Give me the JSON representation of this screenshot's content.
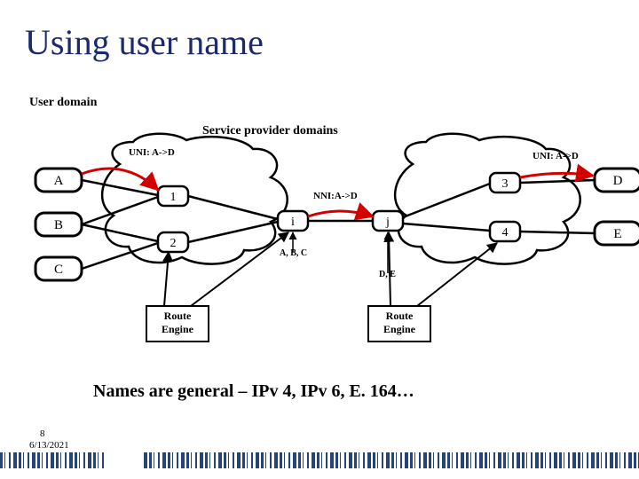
{
  "title": "Using user name",
  "labels": {
    "user_domain": "User domain",
    "service_domains": "Service provider domains",
    "uni_left": "UNI: A->D",
    "uni_right": "UNI: A->D",
    "nni": "NNI:A->D",
    "abc": "A, B, C",
    "de": "D, E",
    "route_engine": "Route\nEngine"
  },
  "nodes": {
    "A": "A",
    "B": "B",
    "C": "C",
    "D": "D",
    "E": "E",
    "n1": "1",
    "n2": "2",
    "n3": "3",
    "n4": "4",
    "i": "i",
    "j": "j"
  },
  "caption": "Names are general – IPv 4, IPv 6, E. 164…",
  "footer": {
    "page": "8",
    "date": "6/13/2021"
  }
}
